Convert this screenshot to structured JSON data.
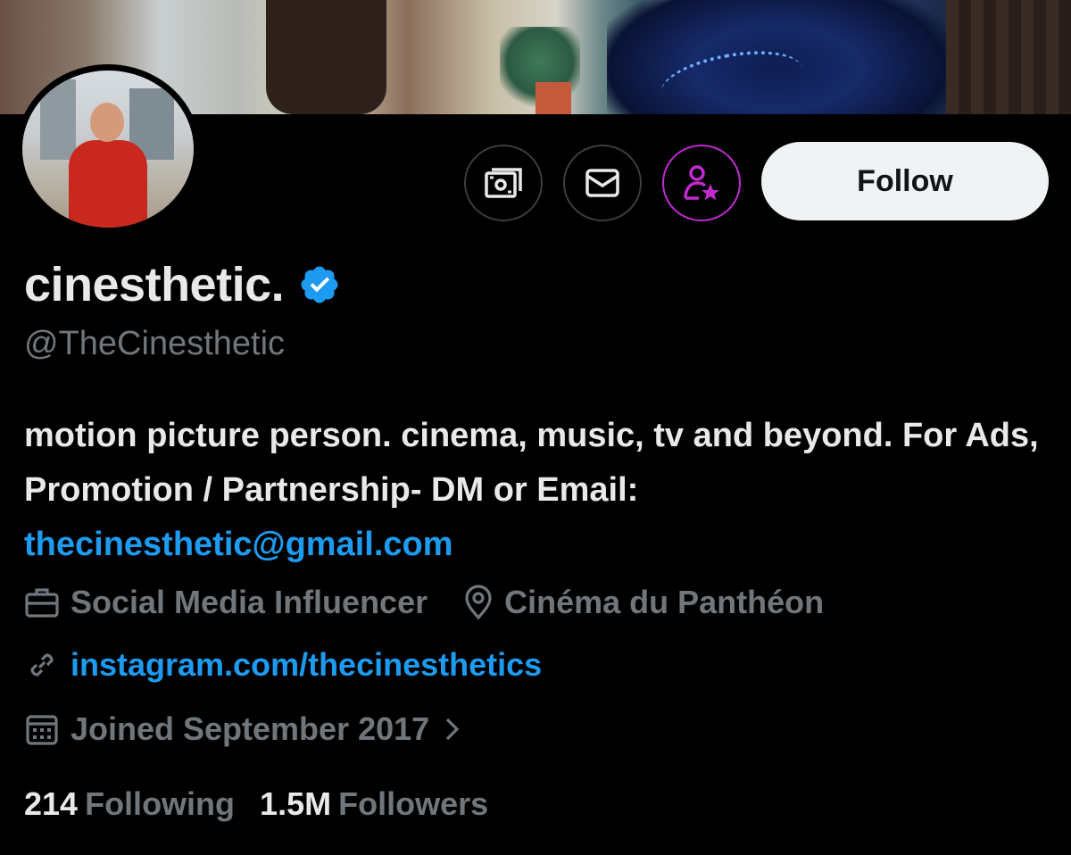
{
  "profile": {
    "display_name": "cinesthetic.",
    "handle": "@TheCinesthetic",
    "bio_text": "motion picture person. cinema, music, tv and beyond. For Ads, Promotion / Partnership- DM or Email: ",
    "bio_email": "thecinesthetic@gmail.com",
    "category": "Social Media Influencer",
    "location": "Cinéma du Panthéon",
    "website": "instagram.com/thecinesthetics",
    "joined": "Joined September 2017",
    "following_count": "214",
    "following_label": "Following",
    "followers_count": "1.5M",
    "followers_label": "Followers"
  },
  "actions": {
    "follow_label": "Follow",
    "icons": [
      "money-icon",
      "envelope-icon",
      "subscribe-person-star-icon"
    ]
  },
  "colors": {
    "background": "#000000",
    "text_primary": "#e7e9ea",
    "text_secondary": "#71767b",
    "link": "#1d9bf0",
    "verified": "#1d9bf0",
    "subscribe_accent": "#c02bd0",
    "follow_button_bg": "#eff3f4"
  }
}
